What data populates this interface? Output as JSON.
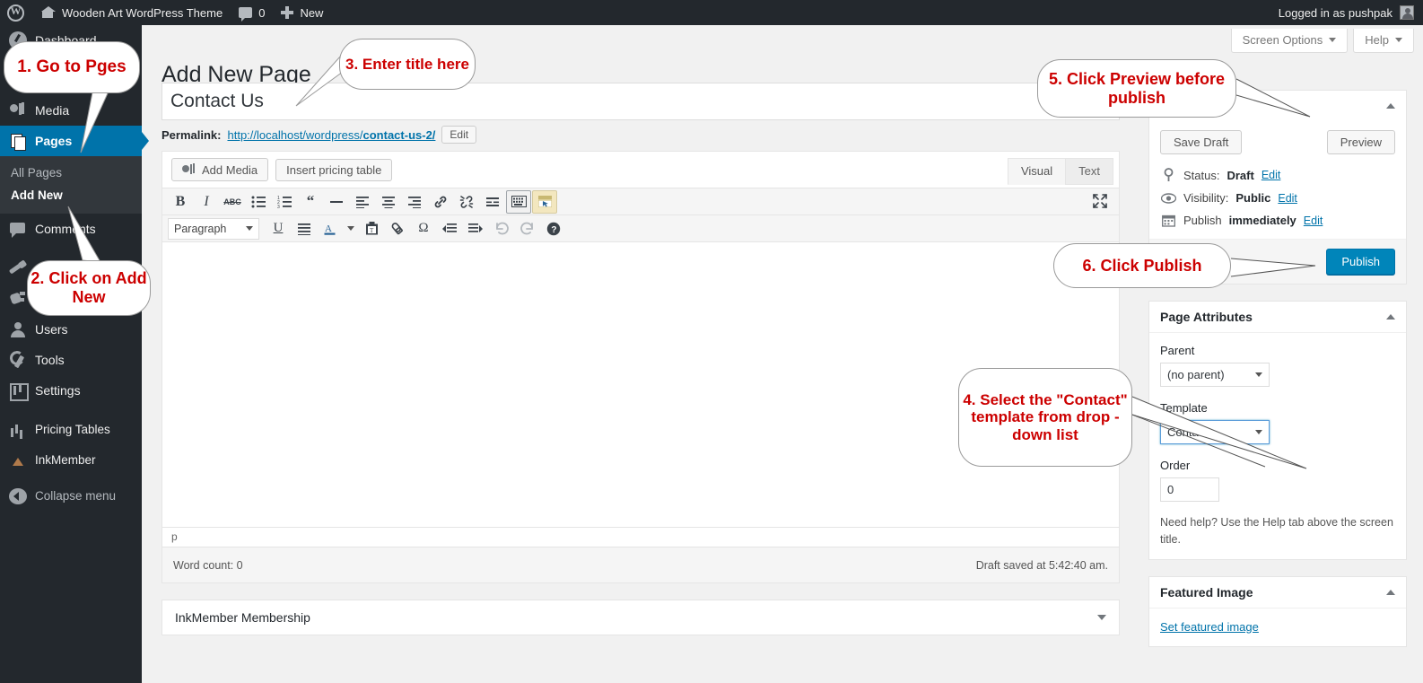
{
  "adminbar": {
    "wp_logo": "wordpress-logo-icon",
    "site_name": "Wooden Art WordPress Theme",
    "comment_count": "0",
    "new_label": "New",
    "account_label": "Logged in as pushpak"
  },
  "sidebar": {
    "items": [
      {
        "label": "Dashboard",
        "icon": "dashboard-icon",
        "current": false
      },
      {
        "label": "Media",
        "icon": "media-icon",
        "current": false
      },
      {
        "label": "Pages",
        "icon": "pages-icon",
        "current": true
      },
      {
        "label": "Comments",
        "icon": "comments-icon",
        "current": false
      },
      {
        "label": "Appearance",
        "icon": "appearance-brush-icon",
        "current": false
      },
      {
        "label": "Plugins",
        "icon": "plugins-icon",
        "current": false
      },
      {
        "label": "Users",
        "icon": "users-icon",
        "current": false
      },
      {
        "label": "Tools",
        "icon": "tools-wrench-icon",
        "current": false
      },
      {
        "label": "Settings",
        "icon": "settings-icon",
        "current": false
      },
      {
        "label": "Pricing Tables",
        "icon": "bar-chart-icon",
        "current": false
      },
      {
        "label": "InkMember",
        "icon": "inkmember-icon",
        "current": false
      }
    ],
    "submenu": [
      {
        "label": "All Pages",
        "active": false
      },
      {
        "label": "Add New",
        "active": true
      }
    ],
    "collapse_label": "Collapse menu"
  },
  "screen_meta": {
    "screen_options": "Screen Options",
    "help": "Help"
  },
  "page": {
    "title_heading": "Add New Page",
    "title_value": "Contact Us",
    "title_placeholder": "Enter title here"
  },
  "permalink": {
    "label": "Permalink:",
    "base": "http://localhost/wordpress/",
    "slug": "contact-us-2/",
    "edit_label": "Edit"
  },
  "editor": {
    "add_media_label": "Add Media",
    "insert_pricing_table_label": "Insert pricing table",
    "tabs": [
      {
        "label": "Visual",
        "active": true
      },
      {
        "label": "Text",
        "active": false
      }
    ],
    "toolbar1": [
      {
        "name": "bold-icon",
        "glyph": "B"
      },
      {
        "name": "italic-icon",
        "glyph": "I"
      },
      {
        "name": "strikethrough-icon",
        "glyph": "ABC"
      },
      {
        "name": "bullet-list-icon",
        "glyph": ""
      },
      {
        "name": "numbered-list-icon",
        "glyph": ""
      },
      {
        "name": "blockquote-icon",
        "glyph": "“"
      },
      {
        "name": "horizontal-rule-icon",
        "glyph": "—"
      },
      {
        "name": "align-left-icon",
        "glyph": ""
      },
      {
        "name": "align-center-icon",
        "glyph": ""
      },
      {
        "name": "align-right-icon",
        "glyph": ""
      },
      {
        "name": "insert-link-icon",
        "glyph": ""
      },
      {
        "name": "unlink-icon",
        "glyph": ""
      },
      {
        "name": "read-more-icon",
        "glyph": ""
      },
      {
        "name": "toolbar-toggle-icon",
        "glyph": ""
      },
      {
        "name": "distraction-free-icon",
        "glyph": ""
      }
    ],
    "format_select": "Paragraph",
    "toolbar2": [
      {
        "name": "underline-icon",
        "glyph": "U"
      },
      {
        "name": "justify-icon",
        "glyph": ""
      },
      {
        "name": "text-color-icon",
        "glyph": "A"
      },
      {
        "name": "text-color-caret-icon",
        "glyph": ""
      },
      {
        "name": "paste-as-text-icon",
        "glyph": ""
      },
      {
        "name": "clear-formatting-icon",
        "glyph": ""
      },
      {
        "name": "special-character-icon",
        "glyph": "Ω"
      },
      {
        "name": "outdent-icon",
        "glyph": ""
      },
      {
        "name": "indent-icon",
        "glyph": ""
      },
      {
        "name": "undo-icon",
        "glyph": ""
      },
      {
        "name": "redo-icon",
        "glyph": ""
      },
      {
        "name": "keyboard-shortcuts-icon",
        "glyph": "?"
      }
    ],
    "path": "p",
    "word_count": "Word count: 0",
    "draft_saved": "Draft saved at 5:42:40 am."
  },
  "inkmember_box": {
    "title": "InkMember Membership"
  },
  "publish_box": {
    "save_draft_label": "Save Draft",
    "preview_label": "Preview",
    "status_label": "Status:",
    "status_value": "Draft",
    "status_edit": "Edit",
    "visibility_label": "Visibility:",
    "visibility_value": "Public",
    "visibility_edit": "Edit",
    "publish_label": "Publish",
    "publish_when": "immediately",
    "publish_edit": "Edit",
    "publish_button": "Publish"
  },
  "page_attributes": {
    "title": "Page Attributes",
    "parent_label": "Parent",
    "parent_value": "(no parent)",
    "template_label": "Template",
    "template_value": "Contact",
    "order_label": "Order",
    "order_value": "0",
    "help_text": "Need help? Use the Help tab above the screen title."
  },
  "featured_image": {
    "title": "Featured Image",
    "link_label": "Set featured image"
  },
  "callouts": [
    {
      "id": 1,
      "text": "1. Go to Pges"
    },
    {
      "id": 2,
      "text": "2. Click on Add New"
    },
    {
      "id": 3,
      "text": "3. Enter title here"
    },
    {
      "id": 4,
      "text": "4. Select the \"Contact\" template from drop - down list"
    },
    {
      "id": 5,
      "text": "5. Click Preview before publish"
    },
    {
      "id": 6,
      "text": "6. Click Publish"
    }
  ],
  "colors": {
    "admin_dark": "#23282d",
    "admin_submenu": "#32373c",
    "accent_blue": "#0073aa",
    "publish_blue": "#0085ba",
    "link_blue": "#0073aa",
    "callout_red": "#cc0000",
    "page_bg": "#f1f1f1"
  }
}
